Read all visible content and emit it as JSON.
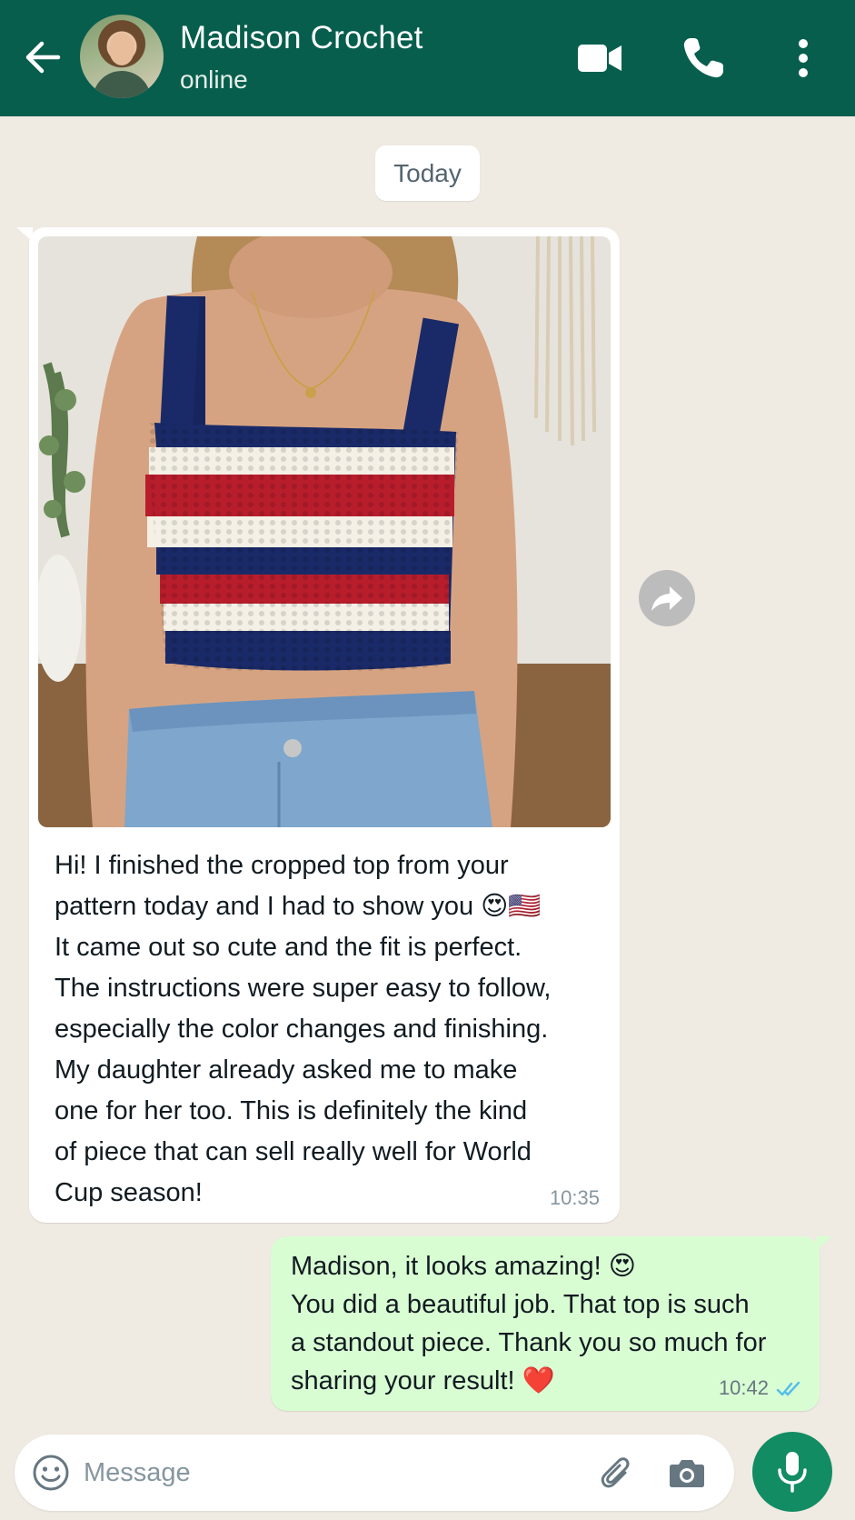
{
  "header": {
    "contact_name": "Madison Crochet",
    "status": "online",
    "icons": [
      "back-arrow-icon",
      "video-call-icon",
      "phone-icon",
      "more-options-icon"
    ]
  },
  "chat": {
    "date_label": "Today",
    "incoming": {
      "text": "Hi! I finished the cropped top from your\npattern today and I had to show you 😍🇺🇸\nIt came out so cute and the fit is perfect.\nThe instructions were super easy to follow,\nespecially the color changes and finishing.\nMy daughter already asked me to make\none for her too. This is definitely the kind\nof piece that can sell really well for World\nCup season!",
      "time": "10:35"
    },
    "outgoing": {
      "text": "Madison, it looks amazing! 😍\nYou did a beautiful job. That top is such\na standout piece. Thank you so much for\nsharing your result! ❤️",
      "time": "10:42",
      "status": "read"
    }
  },
  "composer": {
    "placeholder": "Message"
  },
  "colors": {
    "header": "#075e4d",
    "chat_bg": "#efeae2",
    "outgoing_bubble": "#d9fdd3",
    "incoming_bubble": "#ffffff",
    "mic_button": "#128c63",
    "read_ticks": "#53bdeb"
  }
}
